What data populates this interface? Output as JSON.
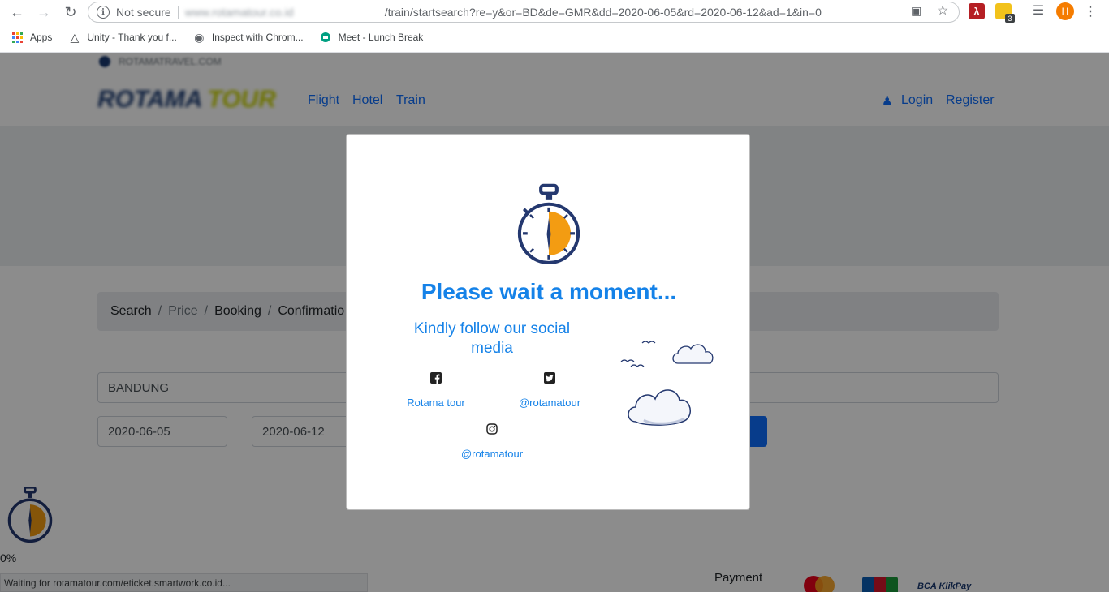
{
  "browser": {
    "security_label": "Not secure",
    "url_host": "www.rotamatour.co.id",
    "url_path": "/train/startsearch?re=y&or=BD&de=GMR&dd=2020-06-05&rd=2020-06-12&ad=1&in=0",
    "extension_badge": "3",
    "profile_initial": "H",
    "bookmarks": [
      {
        "label": "Apps"
      },
      {
        "label": "Unity - Thank you f..."
      },
      {
        "label": "Inspect with Chrom..."
      },
      {
        "label": "Meet - Lunch Break"
      }
    ]
  },
  "site": {
    "top_text": "ROTAMATRAVEL.COM",
    "logo_text_a": "ROTAMA",
    "logo_text_b": "TOUR",
    "nav": [
      "Flight",
      "Hotel",
      "Train"
    ],
    "login": "Login",
    "register": "Register"
  },
  "breadcrumb": {
    "items": [
      "Search",
      "Price",
      "Booking",
      "Confirmatio"
    ],
    "separator": "/"
  },
  "form": {
    "origin": "BANDUNG",
    "depart_date": "2020-06-05",
    "return_date": "2020-06-12"
  },
  "loading": {
    "percent_text": "0%"
  },
  "status_bar": {
    "text": "Waiting for rotamatour.com/eticket.smartwork.co.id..."
  },
  "footer": {
    "payment_label": "Payment",
    "bca_label": "BCA KlikPay"
  },
  "modal": {
    "title": "Please wait a moment...",
    "social_heading": "Kindly follow our social media",
    "facebook": "Rotama tour",
    "twitter": "@rotamatour",
    "instagram": "@rotamatour"
  },
  "colors": {
    "accent": "#1582e8",
    "stopwatch_navy": "#24386f",
    "stopwatch_orange": "#f39c12"
  }
}
